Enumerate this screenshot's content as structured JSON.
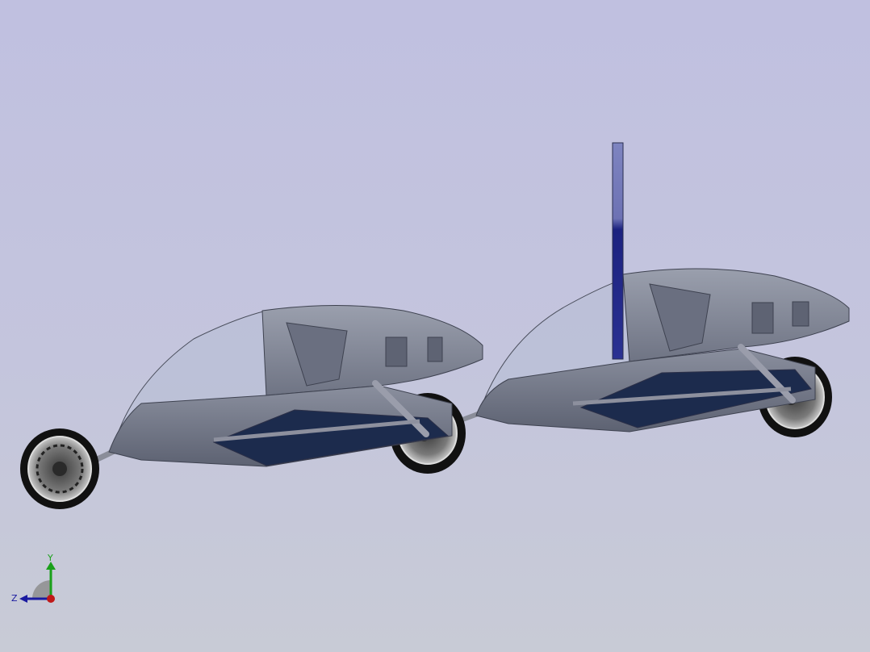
{
  "viewport": {
    "background_top": "#c0c0e0",
    "background_bottom": "#c8cbd6"
  },
  "model": {
    "body_color": "#7b8090",
    "floor_color": "#1c2b4d",
    "canopy_color": "#b8bfd6",
    "flag_color": "#1a237e",
    "tire_color": "#111111"
  },
  "triad": {
    "y_label": "Y",
    "z_label": "Z",
    "y_color": "#1aa01a",
    "z_color": "#1a1aa0",
    "x_color": "#c01818"
  }
}
